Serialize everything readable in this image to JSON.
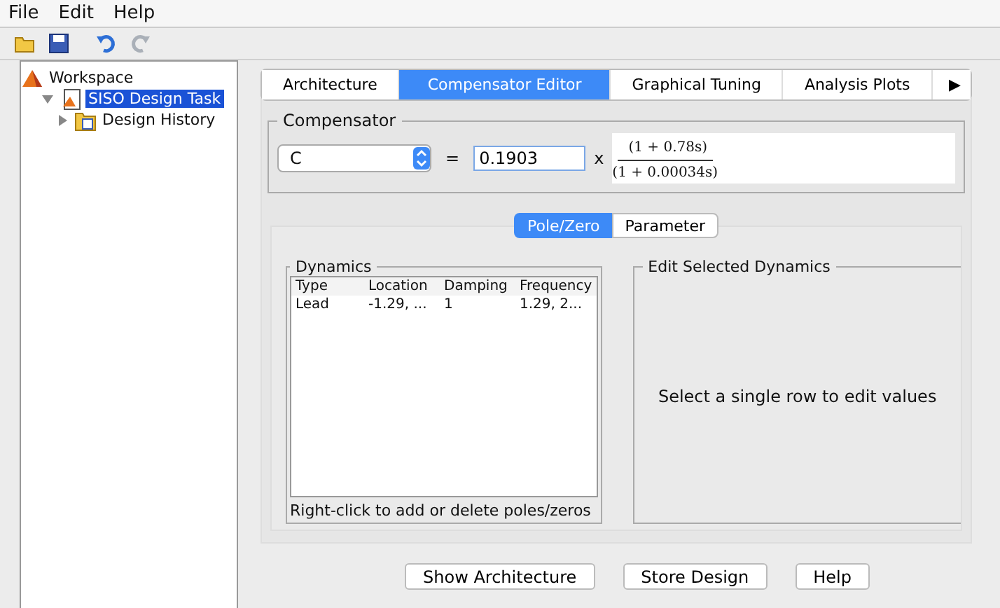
{
  "menu": [
    "File",
    "Edit",
    "Help"
  ],
  "toolbar": [
    {
      "kind": "open"
    },
    {
      "kind": "save"
    },
    {
      "kind": "undo",
      "disabled": false
    },
    {
      "kind": "redo",
      "disabled": true
    }
  ],
  "tree": [
    {
      "label": "Workspace",
      "kind": "workspace",
      "selected": false,
      "children": [
        {
          "label": "SISO Design Task",
          "kind": "task",
          "selected": true,
          "expanded": true,
          "children": [
            {
              "label": "Design History",
              "kind": "history",
              "selected": false,
              "expanded": false
            }
          ]
        }
      ]
    }
  ],
  "tabs": [
    {
      "label": "Architecture",
      "selected": false
    },
    {
      "label": "Compensator Editor",
      "selected": true
    },
    {
      "label": "Graphical Tuning",
      "selected": false
    },
    {
      "label": "Analysis Plots",
      "selected": false
    },
    {
      "label": "▶",
      "selected": false
    }
  ],
  "compensator": {
    "title": "Compensator",
    "name": "C",
    "equals": "=",
    "gain": "0.1903",
    "times": "x",
    "numerator": "(1 + 0.78s)",
    "denominator": "(1 + 0.00034s)"
  },
  "subtabs": [
    {
      "label": "Pole/Zero",
      "selected": true
    },
    {
      "label": "Parameter",
      "selected": false
    }
  ],
  "dynamics": {
    "title": "Dynamics",
    "columns": [
      "Type",
      "Location",
      "Damping",
      "Frequency"
    ],
    "rows": [
      [
        "Lead",
        "-1.29, ...",
        "1",
        "1.29, 2..."
      ]
    ],
    "hint": "Right-click to add or delete poles/zeros"
  },
  "edit": {
    "title": "Edit Selected Dynamics",
    "message": "Select a single row to edit values"
  },
  "buttons": [
    "Show Architecture",
    "Store Design",
    "Help"
  ]
}
